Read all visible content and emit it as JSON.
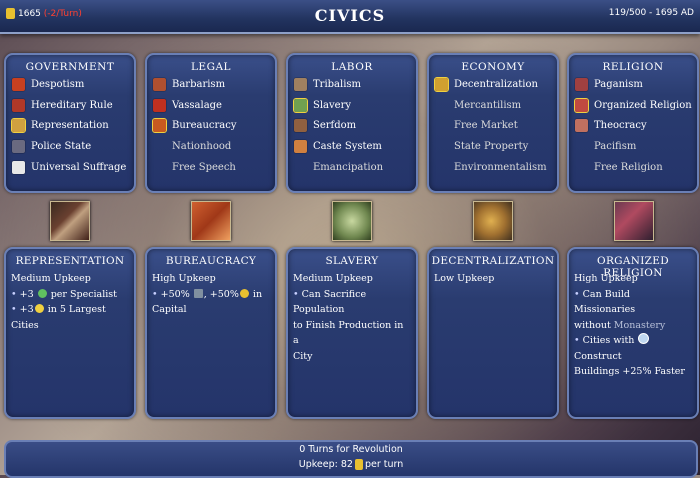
{
  "header": {
    "title": "CIVICS",
    "gold": "1665",
    "gold_rate": "(-2/Turn)",
    "turn_info": "119/500 - 1695 AD"
  },
  "categories": [
    {
      "name": "GOVERNMENT",
      "selected": "Representation",
      "civics": [
        {
          "label": "Despotism",
          "icon": "despotism-icon",
          "available": true
        },
        {
          "label": "Hereditary Rule",
          "icon": "hereditary-rule-icon",
          "available": true
        },
        {
          "label": "Representation",
          "icon": "representation-icon",
          "available": true,
          "selected": true
        },
        {
          "label": "Police State",
          "icon": "police-state-icon",
          "available": true
        },
        {
          "label": "Universal Suffrage",
          "icon": "universal-suffrage-icon",
          "available": true
        }
      ]
    },
    {
      "name": "LEGAL",
      "selected": "Bureaucracy",
      "civics": [
        {
          "label": "Barbarism",
          "icon": "barbarism-icon",
          "available": true
        },
        {
          "label": "Vassalage",
          "icon": "vassalage-icon",
          "available": true
        },
        {
          "label": "Bureaucracy",
          "icon": "bureaucracy-icon",
          "available": true,
          "selected": true
        },
        {
          "label": "Nationhood",
          "available": false
        },
        {
          "label": "Free Speech",
          "available": false
        }
      ]
    },
    {
      "name": "LABOR",
      "selected": "Slavery",
      "civics": [
        {
          "label": "Tribalism",
          "icon": "tribalism-icon",
          "available": true
        },
        {
          "label": "Slavery",
          "icon": "slavery-icon",
          "available": true,
          "selected": true
        },
        {
          "label": "Serfdom",
          "icon": "serfdom-icon",
          "available": true
        },
        {
          "label": "Caste System",
          "icon": "caste-system-icon",
          "available": true
        },
        {
          "label": "Emancipation",
          "available": false
        }
      ]
    },
    {
      "name": "ECONOMY",
      "selected": "Decentralization",
      "civics": [
        {
          "label": "Decentralization",
          "icon": "decentralization-icon",
          "available": true,
          "selected": true
        },
        {
          "label": "Mercantilism",
          "available": false
        },
        {
          "label": "Free Market",
          "available": false
        },
        {
          "label": "State Property",
          "available": false
        },
        {
          "label": "Environmentalism",
          "available": false
        }
      ]
    },
    {
      "name": "RELIGION",
      "selected": "Organized Religion",
      "civics": [
        {
          "label": "Paganism",
          "icon": "paganism-icon",
          "available": true
        },
        {
          "label": "Organized Religion",
          "icon": "organized-religion-icon",
          "available": true,
          "selected": true
        },
        {
          "label": "Theocracy",
          "icon": "theocracy-icon",
          "available": true
        },
        {
          "label": "Pacifism",
          "available": false
        },
        {
          "label": "Free Religion",
          "available": false
        }
      ]
    }
  ],
  "details": [
    {
      "title": "REPRESENTATION",
      "upkeep": "Medium Upkeep",
      "line1_pre": "+3",
      "line1_post": "per Specialist",
      "line2_pre": "+3",
      "line2_post": "in 5 Largest Cities"
    },
    {
      "title": "BUREAUCRACY",
      "upkeep": "High Upkeep",
      "line1_a": "+50%",
      "line1_b": ", +50%",
      "line1_c": "in",
      "line2": "Capital"
    },
    {
      "title": "SLAVERY",
      "upkeep": "Medium Upkeep",
      "line1": "Can Sacrifice Population",
      "line2": "to Finish Production in a",
      "line3": "City"
    },
    {
      "title": "DECENTRALIZATION",
      "upkeep": "Low Upkeep"
    },
    {
      "title": "ORGANIZED RELIGION",
      "upkeep": "High Upkeep",
      "line1": "Can Build Missionaries",
      "line2_a": "without",
      "line2_b": "Monastery",
      "line3_a": "Cities with",
      "line3_b": "Construct",
      "line4": "Buildings +25% Faster"
    }
  ],
  "footer": {
    "revolution": "0 Turns for Revolution",
    "upkeep_label": "Upkeep: 82",
    "upkeep_suffix": "per turn"
  },
  "colors": {
    "panel": "#2a3c70",
    "border": "#6a7fb5",
    "gold": "#e8c030",
    "negative": "#ff4030"
  }
}
